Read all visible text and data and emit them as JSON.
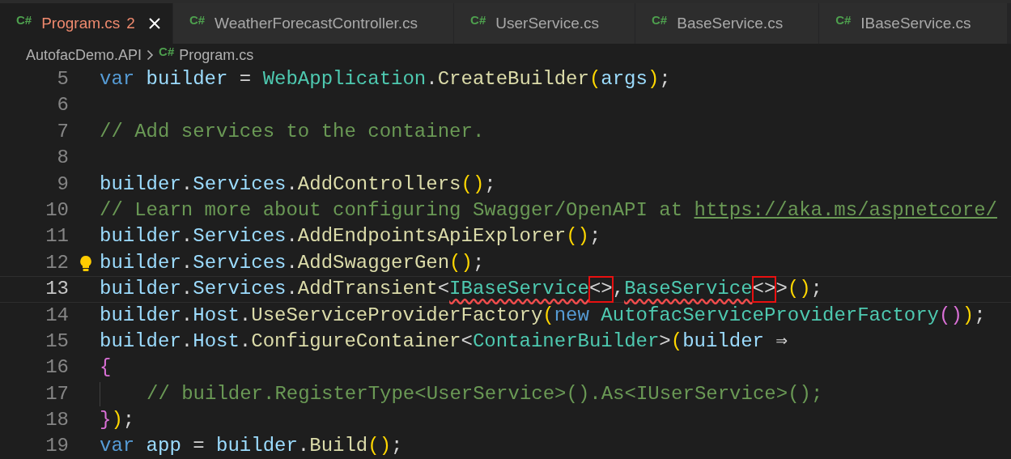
{
  "tabs": [
    {
      "icon": "C#",
      "label": "Program.cs",
      "badge": "2",
      "selected": true
    },
    {
      "icon": "C#",
      "label": "WeatherForecastController.cs",
      "selected": false
    },
    {
      "icon": "C#",
      "label": "UserService.cs",
      "selected": false
    },
    {
      "icon": "C#",
      "label": "BaseService.cs",
      "selected": false
    },
    {
      "icon": "C#",
      "label": "IBaseService.cs",
      "selected": false
    }
  ],
  "breadcrumb": {
    "folder": "AutofacDemo.API",
    "file_icon": "C#",
    "file": "Program.cs"
  },
  "lines": [
    {
      "number": "5",
      "current": false,
      "lightbulb": false,
      "indented": false,
      "tokens": [
        {
          "text": "var",
          "kind": "keyword"
        },
        {
          "text": "builder",
          "kind": "variable"
        },
        {
          "text": "=",
          "kind": "operator"
        },
        {
          "text": "WebApplication",
          "kind": "type"
        },
        {
          "text": ".",
          "kind": "punct"
        },
        {
          "text": "CreateBuilder",
          "kind": "method"
        },
        {
          "text": "(",
          "kind": "paren"
        },
        {
          "text": "args",
          "kind": "variable"
        },
        {
          "text": ")",
          "kind": "paren"
        },
        {
          "text": ";",
          "kind": "punct"
        }
      ]
    },
    {
      "number": "6",
      "current": false,
      "lightbulb": false,
      "indented": false
    },
    {
      "number": "7",
      "current": false,
      "lightbulb": false,
      "indented": false,
      "tokens": [
        {
          "text": "// Add services to the container.",
          "kind": "comment"
        }
      ]
    },
    {
      "number": "8",
      "current": false,
      "lightbulb": false,
      "indented": false
    },
    {
      "number": "9",
      "current": false,
      "lightbulb": false,
      "indented": false,
      "tokens": [
        {
          "text": "builder",
          "kind": "variable"
        },
        {
          "text": ".",
          "kind": "punct"
        },
        {
          "text": "Services",
          "kind": "variable"
        },
        {
          "text": ".",
          "kind": "punct"
        },
        {
          "text": "AddControllers",
          "kind": "method"
        },
        {
          "text": "()",
          "kind": "paren"
        },
        {
          "text": ";",
          "kind": "punct"
        }
      ]
    },
    {
      "number": "10",
      "current": false,
      "lightbulb": false,
      "indented": false,
      "tokens": [
        {
          "text": "// Learn more about configuring Swagger/OpenAPI at",
          "kind": "comment"
        },
        {
          "text": "https://aka.ms/aspnetcore/",
          "kind": "link"
        }
      ]
    },
    {
      "number": "11",
      "current": false,
      "lightbulb": false,
      "indented": false,
      "tokens": [
        {
          "text": "builder",
          "kind": "variable"
        },
        {
          "text": ".",
          "kind": "punct"
        },
        {
          "text": "Services",
          "kind": "variable"
        },
        {
          "text": ".",
          "kind": "punct"
        },
        {
          "text": "AddEndpointsApiExplorer",
          "kind": "method"
        },
        {
          "text": "()",
          "kind": "paren"
        },
        {
          "text": ";",
          "kind": "punct"
        }
      ]
    },
    {
      "number": "12",
      "current": false,
      "lightbulb": true,
      "indented": false,
      "tokens": [
        {
          "text": "builder",
          "kind": "variable"
        },
        {
          "text": ".",
          "kind": "punct"
        },
        {
          "text": "Services",
          "kind": "variable"
        },
        {
          "text": ".",
          "kind": "punct"
        },
        {
          "text": "AddSwaggerGen",
          "kind": "method"
        },
        {
          "text": "()",
          "kind": "paren"
        },
        {
          "text": ";",
          "kind": "punct"
        }
      ]
    },
    {
      "number": "13",
      "current": true,
      "lightbulb": false,
      "indented": false,
      "tokens": [
        {
          "text": "builder",
          "kind": "variable"
        },
        {
          "text": ".",
          "kind": "punct"
        },
        {
          "text": "Services",
          "kind": "variable"
        },
        {
          "text": ".",
          "kind": "punct"
        },
        {
          "text": "AddTransient",
          "kind": "method"
        },
        {
          "text": "<",
          "kind": "punct"
        },
        {
          "text": "IBaseService",
          "kind": "type-error"
        },
        {
          "text": "<>",
          "kind": "boxed"
        },
        {
          "text": ",",
          "kind": "punct"
        },
        {
          "text": "BaseService",
          "kind": "type-error"
        },
        {
          "text": "<>",
          "kind": "boxed"
        },
        {
          "text": ">",
          "kind": "punct"
        },
        {
          "text": "()",
          "kind": "paren"
        },
        {
          "text": ";",
          "kind": "punct"
        }
      ]
    },
    {
      "number": "14",
      "current": false,
      "lightbulb": false,
      "indented": false,
      "tokens": [
        {
          "text": "builder",
          "kind": "variable"
        },
        {
          "text": ".",
          "kind": "punct"
        },
        {
          "text": "Host",
          "kind": "variable"
        },
        {
          "text": ".",
          "kind": "punct"
        },
        {
          "text": "UseServiceProviderFactory",
          "kind": "method"
        },
        {
          "text": "(",
          "kind": "paren"
        },
        {
          "text": "new",
          "kind": "keyword"
        },
        {
          "text": "AutofacServiceProviderFactory",
          "kind": "type"
        },
        {
          "text": "()",
          "kind": "paren-alt"
        },
        {
          "text": ")",
          "kind": "paren"
        },
        {
          "text": ";",
          "kind": "punct"
        }
      ]
    },
    {
      "number": "15",
      "current": false,
      "lightbulb": false,
      "indented": false,
      "tokens": [
        {
          "text": "builder",
          "kind": "variable"
        },
        {
          "text": ".",
          "kind": "punct"
        },
        {
          "text": "Host",
          "kind": "variable"
        },
        {
          "text": ".",
          "kind": "punct"
        },
        {
          "text": "ConfigureContainer",
          "kind": "method"
        },
        {
          "text": "<",
          "kind": "punct"
        },
        {
          "text": "ContainerBuilder",
          "kind": "type"
        },
        {
          "text": ">",
          "kind": "punct"
        },
        {
          "text": "(",
          "kind": "paren"
        },
        {
          "text": "builder",
          "kind": "variable"
        },
        {
          "text": "⇒",
          "kind": "operator"
        }
      ]
    },
    {
      "number": "16",
      "current": false,
      "lightbulb": false,
      "indented": false,
      "tokens": [
        {
          "text": "{",
          "kind": "paren-alt"
        }
      ]
    },
    {
      "number": "17",
      "current": false,
      "lightbulb": false,
      "indented": true,
      "tokens": [
        {
          "text": "// builder.RegisterType<UserService>().As<IUserService>();",
          "kind": "comment"
        }
      ]
    },
    {
      "number": "18",
      "current": false,
      "lightbulb": false,
      "indented": false,
      "tokens": [
        {
          "text": "}",
          "kind": "paren-alt"
        },
        {
          "text": ")",
          "kind": "paren"
        },
        {
          "text": ";",
          "kind": "punct"
        }
      ]
    },
    {
      "number": "19",
      "current": false,
      "lightbulb": false,
      "indented": false,
      "tokens": [
        {
          "text": "var",
          "kind": "keyword"
        },
        {
          "text": "app",
          "kind": "variable"
        },
        {
          "text": "=",
          "kind": "operator"
        },
        {
          "text": "builder",
          "kind": "variable"
        },
        {
          "text": ".",
          "kind": "punct"
        },
        {
          "text": "Build",
          "kind": "method"
        },
        {
          "text": "()",
          "kind": "paren"
        },
        {
          "text": ";",
          "kind": "punct"
        }
      ]
    }
  ]
}
